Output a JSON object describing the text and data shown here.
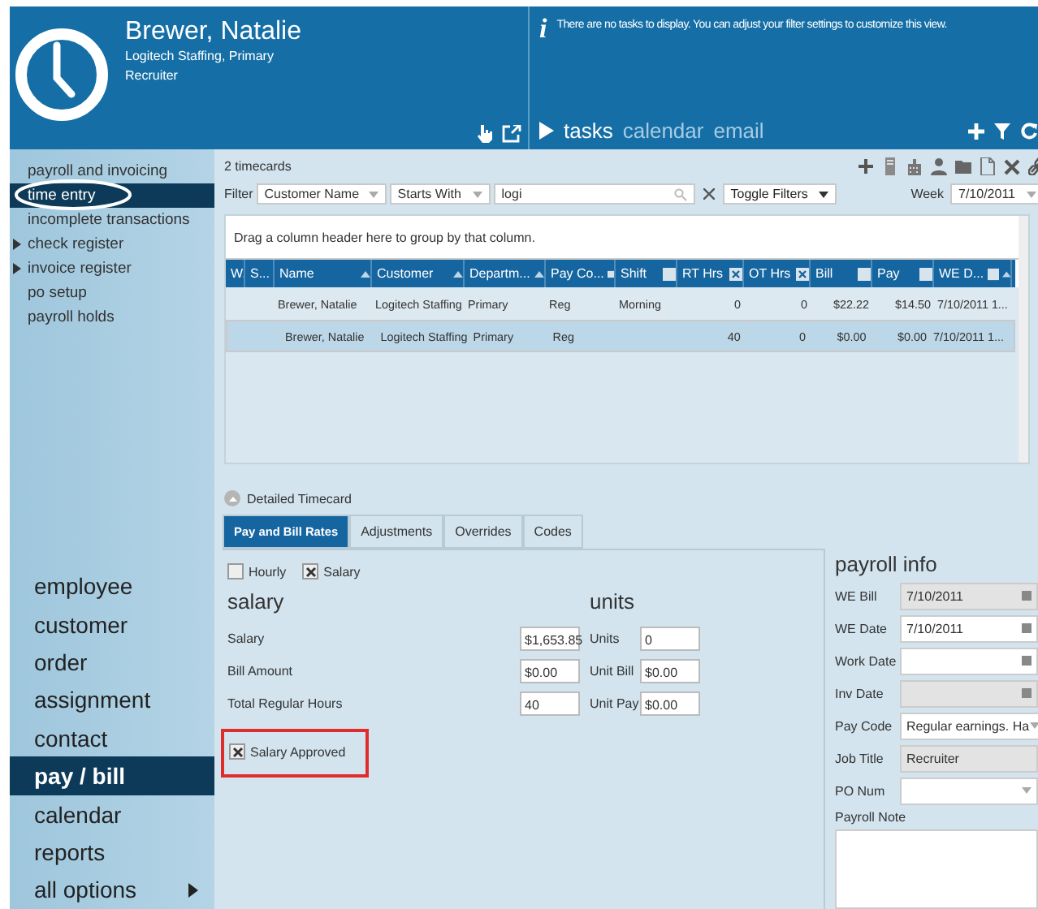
{
  "header": {
    "info_icon": "i",
    "name": "Brewer, Natalie",
    "company": "Logitech Staffing, Primary",
    "role": "Recruiter",
    "info_text": "There are no tasks to display. You can adjust your filter settings to customize this view.",
    "task_tabs": [
      {
        "label": "tasks",
        "selected": true
      },
      {
        "label": "calendar",
        "selected": false
      },
      {
        "label": "email",
        "selected": false
      }
    ]
  },
  "nav_top": [
    {
      "label": "payroll and invoicing",
      "selected": false,
      "expandable": false,
      "circled": false
    },
    {
      "label": "time entry",
      "selected": true,
      "expandable": false,
      "circled": true
    },
    {
      "label": "incomplete transactions",
      "selected": false,
      "expandable": false,
      "circled": false
    },
    {
      "label": "check register",
      "selected": false,
      "expandable": true,
      "circled": false
    },
    {
      "label": "invoice register",
      "selected": false,
      "expandable": true,
      "circled": false
    },
    {
      "label": "po setup",
      "selected": false,
      "expandable": false,
      "circled": false
    },
    {
      "label": "payroll holds",
      "selected": false,
      "expandable": false,
      "circled": false
    }
  ],
  "nav_main": [
    {
      "label": "employee",
      "selected": false,
      "expandable": false
    },
    {
      "label": "customer",
      "selected": false,
      "expandable": false
    },
    {
      "label": "order",
      "selected": false,
      "expandable": false
    },
    {
      "label": "assignment",
      "selected": false,
      "expandable": false
    },
    {
      "label": "contact",
      "selected": false,
      "expandable": false
    },
    {
      "label": "pay / bill",
      "selected": true,
      "expandable": false
    },
    {
      "label": "calendar",
      "selected": false,
      "expandable": false
    },
    {
      "label": "reports",
      "selected": false,
      "expandable": false
    },
    {
      "label": "all options",
      "selected": false,
      "expandable": true
    }
  ],
  "timecards": {
    "count": "2  timecards",
    "filter": {
      "label": "Filter",
      "field": "Customer Name",
      "operator": "Starts With",
      "value": "logi",
      "toggle": "Toggle Filters",
      "week_label": "Week",
      "week": "7/10/2011"
    },
    "group_hint": "Drag a column header here to group by that column.",
    "columns": [
      {
        "label": "W."
      },
      {
        "label": "S..."
      },
      {
        "label": "Name"
      },
      {
        "label": "Customer"
      },
      {
        "label": "Departm..."
      },
      {
        "label": "Pay Co..."
      },
      {
        "label": "Shift"
      },
      {
        "label": "RT Hrs"
      },
      {
        "label": "OT Hrs"
      },
      {
        "label": "Bill"
      },
      {
        "label": "Pay"
      },
      {
        "label": "WE D..."
      }
    ],
    "rows": [
      {
        "selected": false,
        "cells": [
          "",
          "",
          "Brewer, Natalie",
          "Logitech Staffing",
          "Primary",
          "Reg",
          "Morning",
          "0",
          "0",
          "$22.22",
          "$14.50",
          "7/10/2011 1..."
        ]
      },
      {
        "selected": true,
        "cells": [
          "",
          "",
          "Brewer, Natalie",
          "Logitech Staffing",
          "Primary",
          "Reg",
          "",
          "40",
          "0",
          "$0.00",
          "$0.00",
          "7/10/2011 1..."
        ]
      }
    ]
  },
  "detail": {
    "toggle_label": "Detailed Timecard",
    "tabs": [
      {
        "label": "Pay and Bill Rates",
        "selected": true
      },
      {
        "label": "Adjustments",
        "selected": false
      },
      {
        "label": "Overrides",
        "selected": false
      },
      {
        "label": "Codes",
        "selected": false
      }
    ],
    "pay_types": [
      {
        "label": "Hourly",
        "checked": false
      },
      {
        "label": "Salary",
        "checked": true
      }
    ],
    "salary": {
      "heading": "salary",
      "fields": [
        {
          "label": "Salary",
          "value": "$1,653.85"
        },
        {
          "label": "Bill Amount",
          "value": "$0.00"
        },
        {
          "label": "Total Regular Hours",
          "value": "40"
        }
      ]
    },
    "units": {
      "heading": "units",
      "fields": [
        {
          "label": "Units",
          "value": "0"
        },
        {
          "label": "Unit Bill",
          "value": "$0.00"
        },
        {
          "label": "Unit Pay",
          "value": "$0.00"
        }
      ]
    },
    "approved": {
      "label": "Salary Approved",
      "checked": true,
      "outlined": true
    }
  },
  "payroll_info": {
    "heading": "payroll info",
    "fields": [
      {
        "label": "WE Bill",
        "value": "7/10/2011",
        "kind": "date",
        "disabled": true
      },
      {
        "label": "WE Date",
        "value": "7/10/2011",
        "kind": "date",
        "disabled": false
      },
      {
        "label": "Work Date",
        "kind": "date",
        "disabled": false
      },
      {
        "label": "Inv Date",
        "kind": "date",
        "disabled": true
      },
      {
        "label": "Pay Code",
        "value": "Regular earnings. Ha",
        "kind": "dropdown",
        "disabled": false
      },
      {
        "label": "Job Title",
        "value": "Recruiter",
        "kind": "text",
        "disabled": true
      },
      {
        "label": "PO Num",
        "kind": "dropdown",
        "disabled": false
      }
    ],
    "note_label": "Payroll Note"
  }
}
